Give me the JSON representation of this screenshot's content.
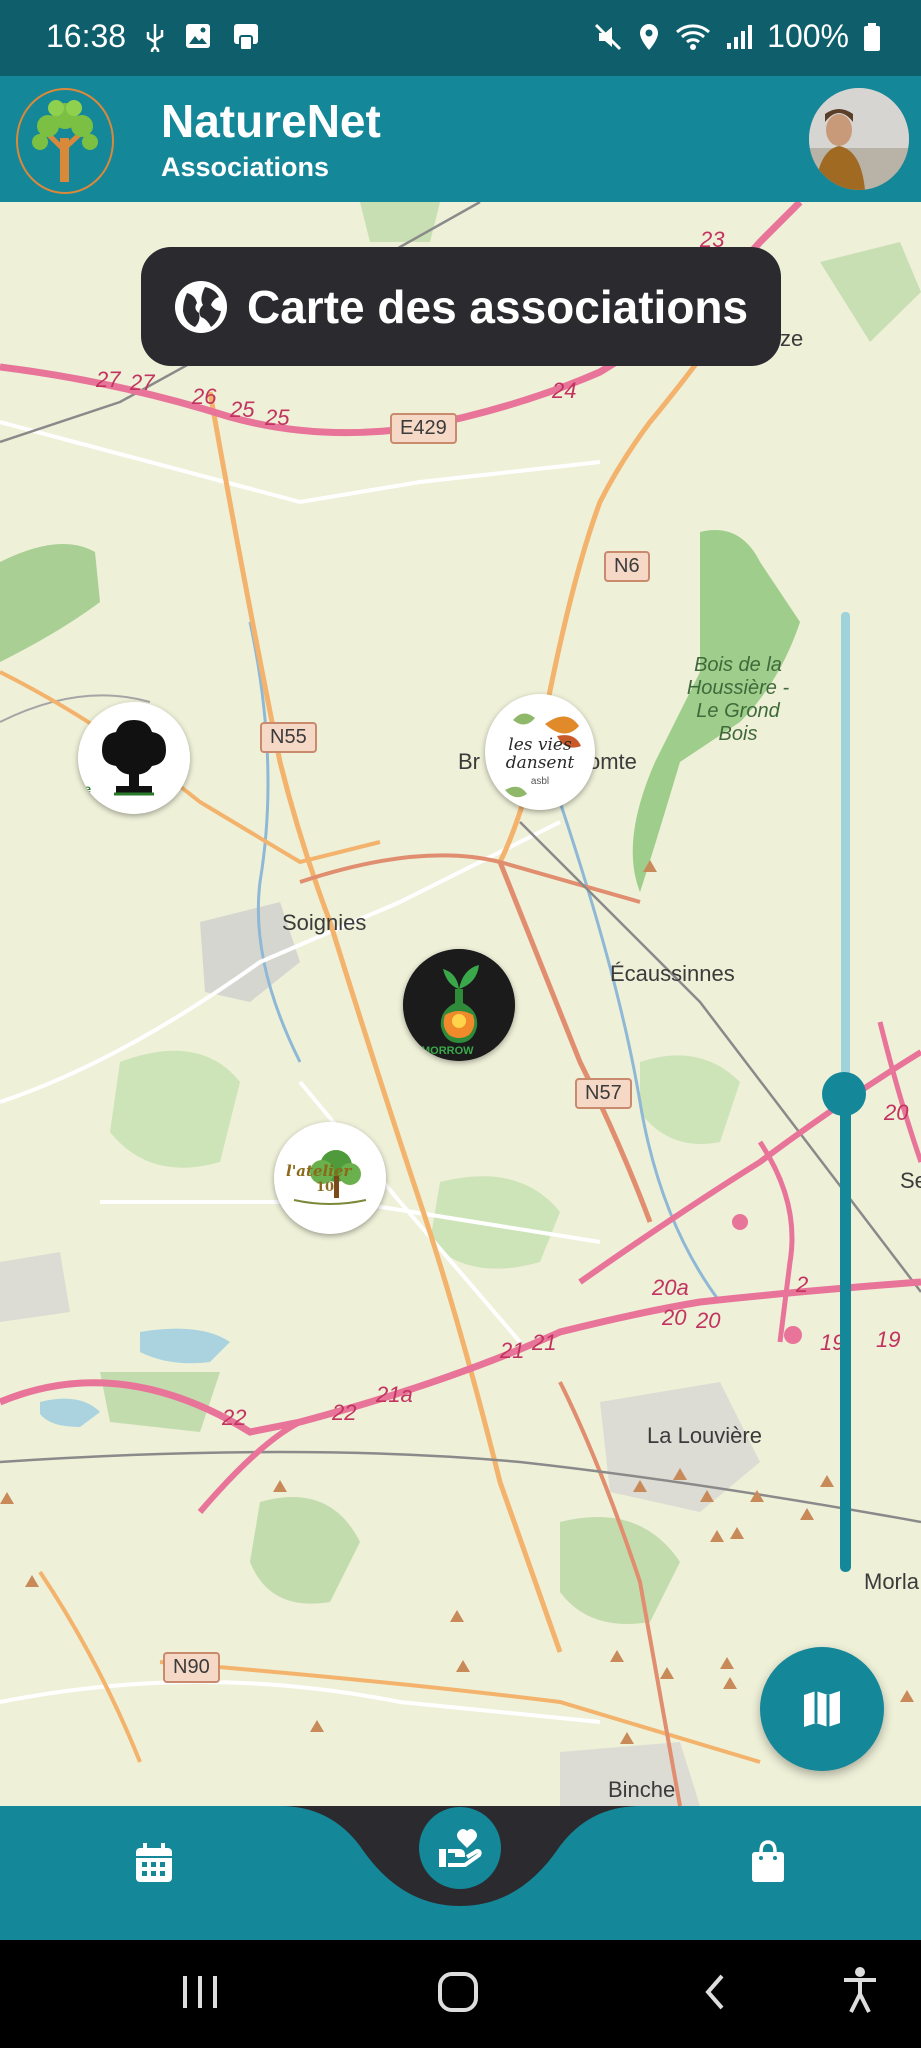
{
  "status_bar": {
    "time": "16:38",
    "battery": "100%",
    "left_icons": [
      "usb-icon",
      "image-icon",
      "payment-card-icon"
    ],
    "right_icons": [
      "mute-icon",
      "location-icon",
      "wifi-icon",
      "signal-icon",
      "battery-icon"
    ]
  },
  "app_bar": {
    "title": "NatureNet",
    "subtitle": "Associations",
    "logo_icon": "tree-logo-icon",
    "avatar_icon": "user-avatar"
  },
  "map": {
    "title": "Carte des associations",
    "title_icon": "globe-icon",
    "place_labels": [
      "Tubize",
      "Bois de la Houssière - Le Grond Bois",
      "Écaussinnes",
      "La Louvière",
      "Binche",
      "Morla",
      "Se",
      "Br",
      "omte",
      "Soignies"
    ],
    "road_labels": [
      "E429",
      "N6",
      "N55",
      "N57",
      "N90"
    ],
    "road_numbers": [
      "27",
      "27",
      "26",
      "25",
      "25",
      "24",
      "23",
      "22",
      "22",
      "21a",
      "21",
      "21",
      "20a",
      "20",
      "20",
      "20",
      "19",
      "19",
      "2"
    ],
    "marker_texts": [
      "Bee",
      "les vies dansent",
      "asbl",
      "l'atelier",
      "10",
      "MORROW"
    ],
    "markers": [
      {
        "name": "tree-association-marker"
      },
      {
        "name": "les-vies-dansent-marker"
      },
      {
        "name": "atelier-marker"
      },
      {
        "name": "morrow-marker"
      }
    ]
  },
  "zoom_slider": {
    "level": 0.48
  },
  "fab": {
    "icon": "map-icon"
  },
  "bottom_nav": {
    "items": [
      {
        "icon": "calendar-icon"
      },
      {
        "icon": "heart-hand-icon",
        "active": true
      },
      {
        "icon": "shopping-bag-icon"
      }
    ]
  },
  "system_nav": [
    "recents-icon",
    "home-icon",
    "back-icon",
    "accessibility-icon"
  ],
  "colors": {
    "primary": "#148799",
    "status_bar": "#0f5e6c",
    "dark_pill": "#2b2a2e",
    "map_bg": "#eef0d8"
  }
}
